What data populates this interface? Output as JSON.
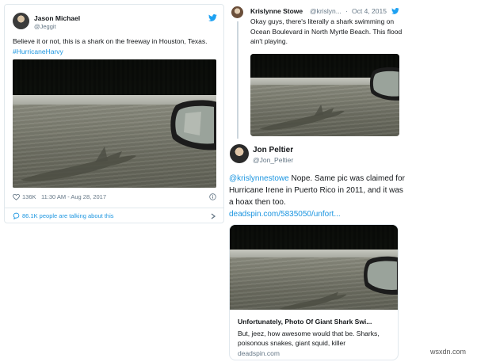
{
  "left_tweet": {
    "name": "Jason Michael",
    "handle": "@Jeggit",
    "text_plain": "Believe it or not, this is a shark on the freeway in Houston, Texas. ",
    "hashtag": "#HurricaneHarvy",
    "likes": "136K",
    "timestamp": "11:30 AM - Aug 28, 2017",
    "conversation": "86.1K people are talking about this"
  },
  "reply_tweet": {
    "name": "Krislynne Stowe",
    "handle": "@krislyn...",
    "date": "Oct 4, 2015",
    "text": "Okay guys, there's literally a shark swimming on Ocean Boulevard in North Myrtle Beach. This flood ain't playing."
  },
  "main_tweet": {
    "name": "Jon Peltier",
    "handle": "@Jon_Peltier",
    "mention": "@krislynnestowe",
    "text": " Nope. Same pic was claimed for Hurricane Irene in Puerto Rico in 2011, and it was a hoax then too.",
    "link": "deadspin.com/5835050/unfort..."
  },
  "link_card": {
    "title": "Unfortunately, Photo Of Giant Shark Swi...",
    "description": "But, jeez, how awesome would that be. Sharks, poisonous snakes, giant squid, killer",
    "domain": "deadspin.com"
  },
  "watermark": "wsxdn.com",
  "colors": {
    "twitter_blue": "#1da1f2",
    "link_blue": "#1b95e0",
    "muted": "#657786",
    "border": "#e1e8ed"
  },
  "icons": [
    "twitter-bird-icon",
    "heart-icon",
    "info-icon",
    "comment-icon",
    "chevron-right-icon"
  ]
}
